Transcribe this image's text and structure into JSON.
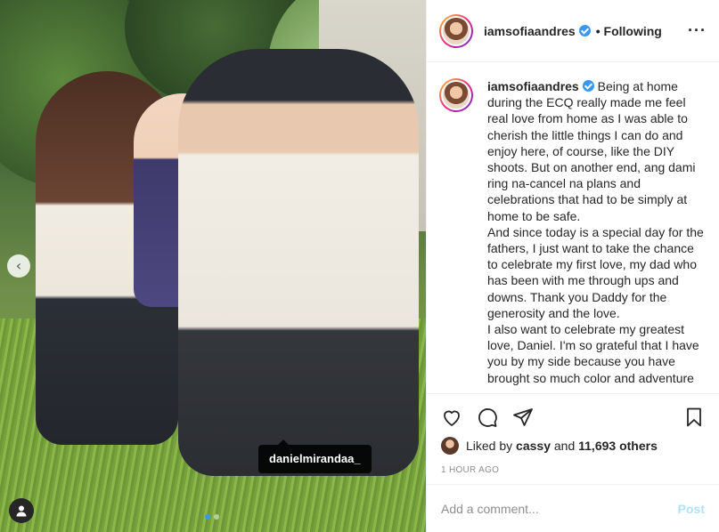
{
  "post": {
    "tagged_username": "danielmirandaa_"
  },
  "header": {
    "username": "iamsofiaandres",
    "separator": "•",
    "follow_status": "Following",
    "more_icon": "more-options-icon"
  },
  "caption": {
    "username": "iamsofiaandres",
    "text": "Being at home during the ECQ really made me feel real love from home as I was able to cherish the little things I can do and enjoy here, of course, like the DIY shoots. But on another end, ang dami ring na-cancel na plans and celebrations that had to be simply at home to be safe.\nAnd since today is a special day for the fathers, I just want to take the chance to celebrate my first love, my dad who has been with me through ups and downs. Thank you Daddy for the generosity and the love.\nI also want to celebrate my greatest love, Daniel. I'm so grateful that I have you by my side because you have brought so much color and adventure"
  },
  "actions": {
    "like_icon": "heart-icon",
    "comment_icon": "comment-icon",
    "share_icon": "share-icon",
    "save_icon": "bookmark-icon"
  },
  "likes": {
    "prefix": "Liked by",
    "user": "cassy",
    "connector": "and",
    "count": "11,693 others"
  },
  "timestamp": "1 HOUR AGO",
  "comment": {
    "placeholder": "Add a comment...",
    "post_label": "Post"
  },
  "colors": {
    "accent": "#3897f0",
    "post_disabled": "#b2dffc",
    "muted": "#8e8e8e"
  }
}
